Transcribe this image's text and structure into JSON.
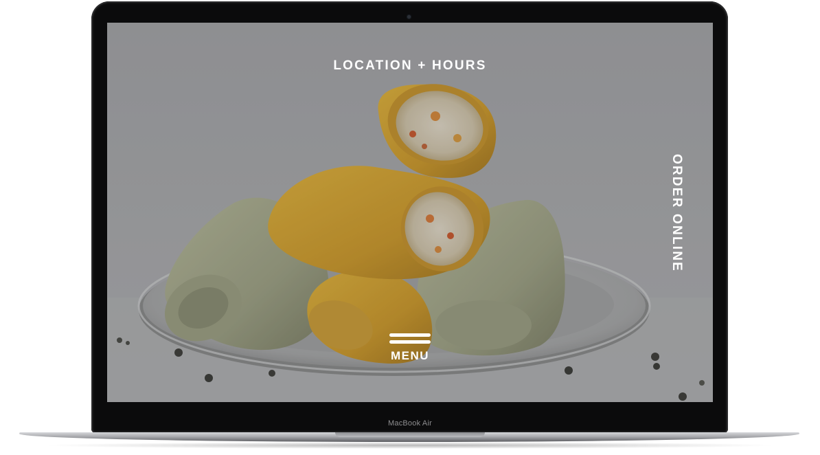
{
  "device": {
    "model_label": "MacBook Air"
  },
  "nav": {
    "location_hours": "LOCATION + HOURS",
    "order_online": "ORDER ONLINE",
    "menu_label": "MENU"
  },
  "hero": {
    "icon": "hamburger-icon",
    "colors": {
      "overlay_text": "#ffffff",
      "background": "#a0a1a4",
      "tortilla_yellow": "#d9a630",
      "tortilla_green": "#a9ad8f",
      "plate": "#c4c5c6"
    }
  }
}
